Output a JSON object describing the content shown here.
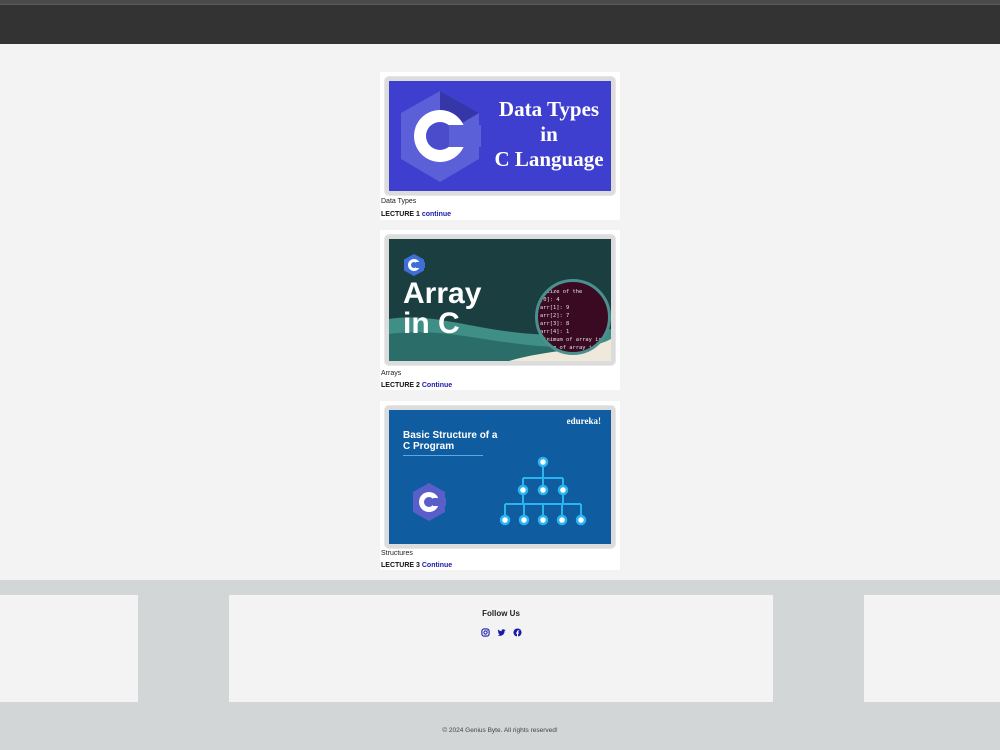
{
  "lectures": [
    {
      "thumb_heading_lines": [
        "Data Types",
        "in",
        "C Language"
      ],
      "title": "Data Types",
      "lecture_label": "LECTURE 1",
      "link_text": "continue"
    },
    {
      "thumb_heading_lines": [
        "Array",
        "in C"
      ],
      "thumb_code": "l size of the\n[0]: 4\narr[1]: 9\narr[2]: 7\narr[3]: 8\narr[4]: 1\nminimum of array is\nmimum of array is",
      "title": "Arrays",
      "lecture_label": "LECTURE 2",
      "link_text": "Continue"
    },
    {
      "thumb_heading_lines": [
        "Basic Structure of a",
        "C Program"
      ],
      "thumb_brand": "edureka!",
      "title": "Structures",
      "lecture_label": "LECTURE 3",
      "link_text": "Continue"
    }
  ],
  "footer": {
    "follow_title": "Follow Us",
    "social_icons": [
      "instagram-icon",
      "twitter-icon",
      "facebook-icon"
    ],
    "copyright": "© 2024 Genius Byte. All rights reserved!"
  },
  "colors": {
    "topbar": "#333333",
    "link": "#1a1aa8",
    "footer_band": "#d2d6d6"
  }
}
